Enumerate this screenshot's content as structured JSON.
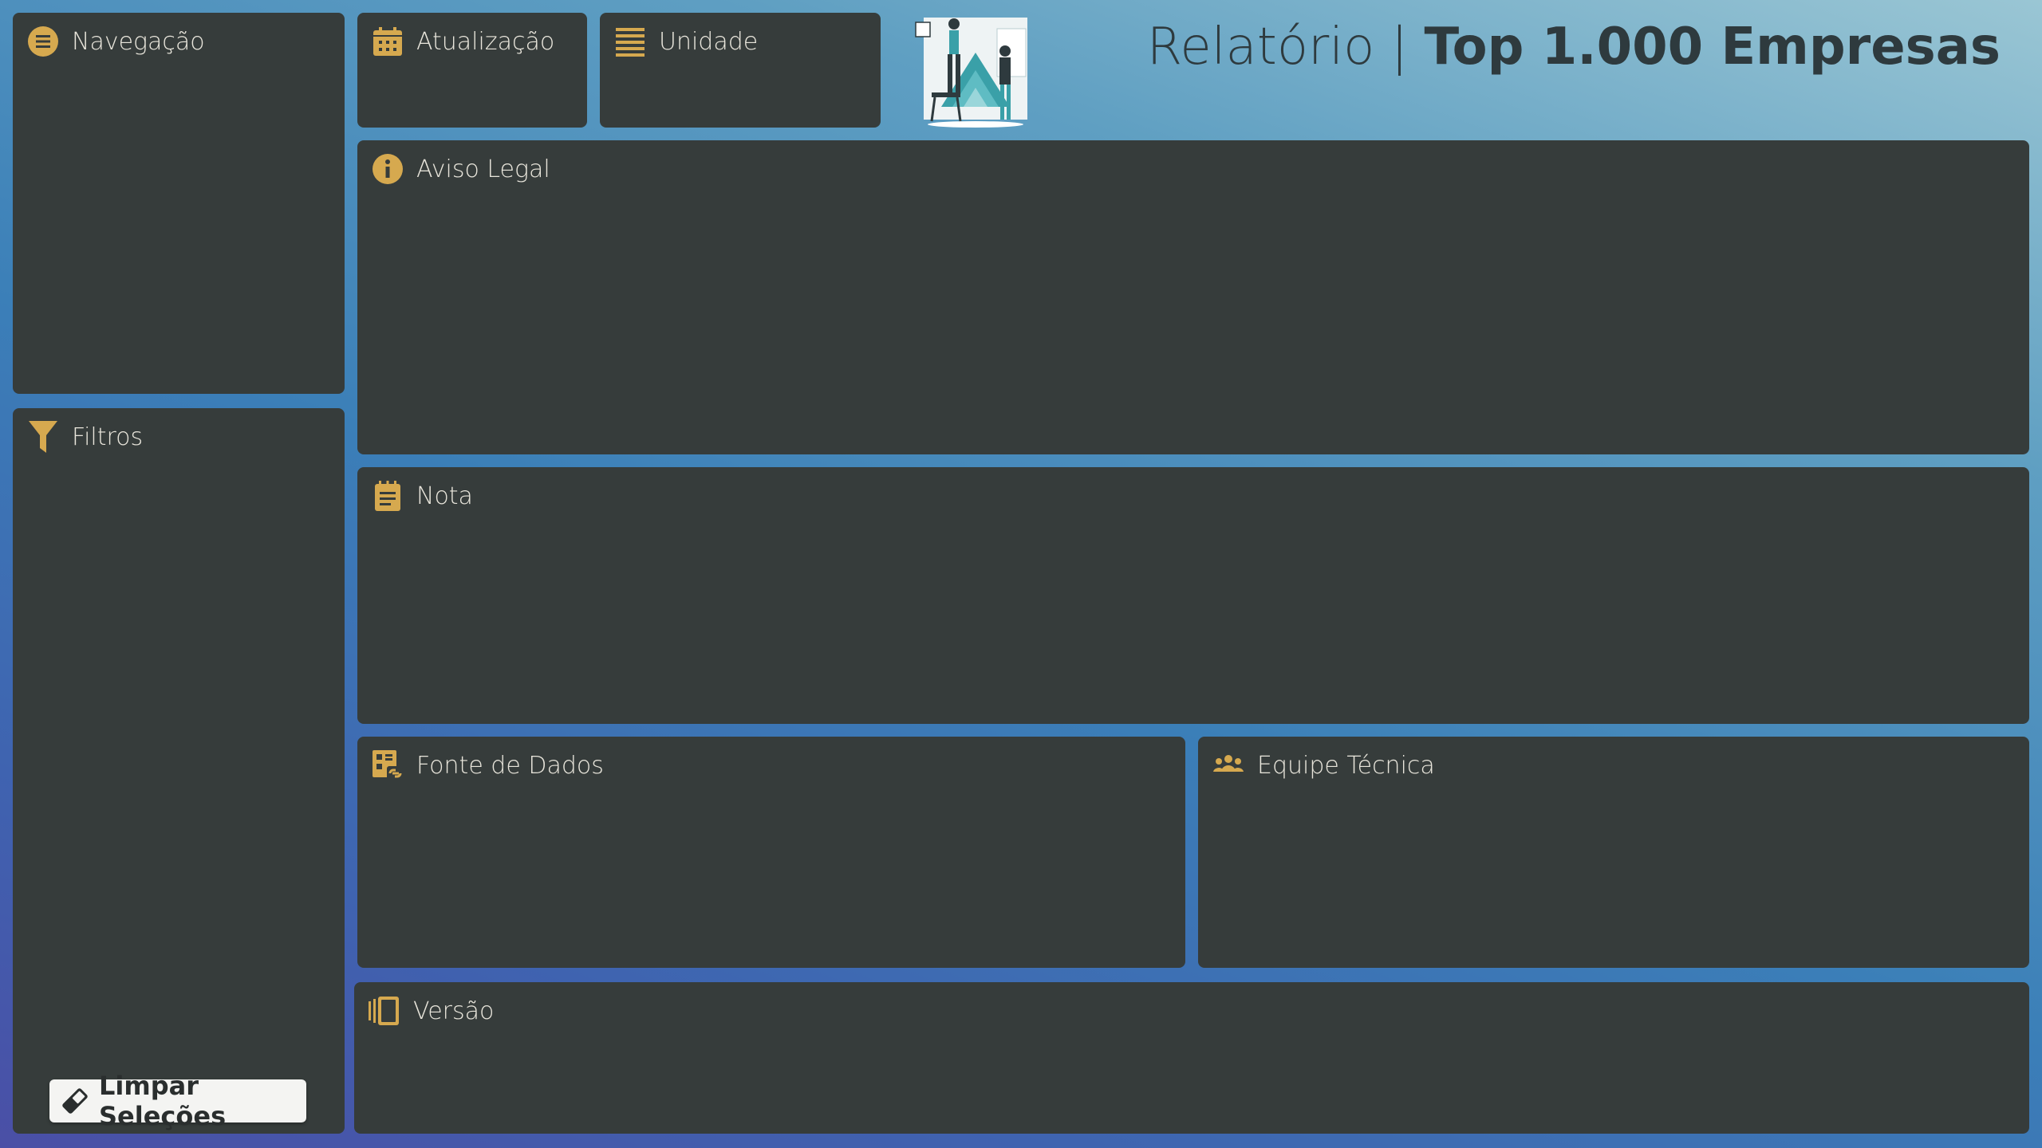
{
  "header": {
    "title_prefix": "Relatório",
    "title_separator": "|",
    "title_main": "Top 1.000 Empresas"
  },
  "panels": {
    "navegacao": {
      "label": "Navegação",
      "icon": "menu-icon"
    },
    "filtros": {
      "label": "Filtros",
      "icon": "filter-icon"
    },
    "atualizacao": {
      "label": "Atualização",
      "icon": "calendar-icon"
    },
    "unidade": {
      "label": "Unidade",
      "icon": "list-icon"
    },
    "aviso": {
      "label": "Aviso Legal",
      "icon": "info-icon"
    },
    "nota": {
      "label": "Nota",
      "icon": "note-icon"
    },
    "fonte": {
      "label": "Fonte de Dados",
      "icon": "data-source-icon"
    },
    "equipe": {
      "label": "Equipe Técnica",
      "icon": "team-icon"
    },
    "versao": {
      "label": "Versão",
      "icon": "version-icon"
    }
  },
  "actions": {
    "clear_label": "Limpar Seleções"
  },
  "colors": {
    "panel_bg": "#363c3b",
    "icon_accent": "#d6a94f",
    "label_text": "#e9e6dc",
    "title_text": "#2e3a3e"
  }
}
